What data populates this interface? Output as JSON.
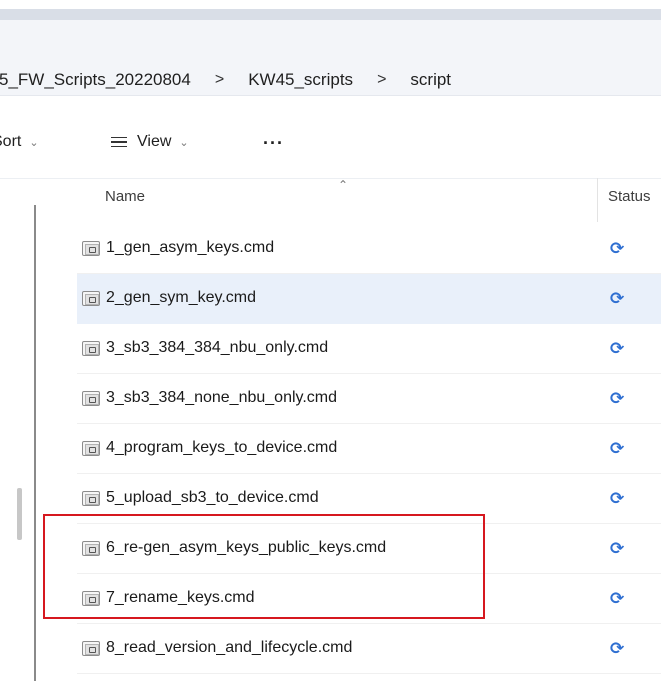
{
  "breadcrumb": {
    "items": [
      "5_FW_Scripts_20220804",
      "KW45_scripts",
      "script"
    ],
    "separator": ">"
  },
  "toolbar": {
    "sort_label": "Sort",
    "view_label": "View",
    "more_label": "..."
  },
  "columns": {
    "name": "Name",
    "status": "Status"
  },
  "files": [
    {
      "name": "1_gen_asym_keys.cmd",
      "status_icon": "sync-pending-icon"
    },
    {
      "name": "2_gen_sym_key.cmd",
      "status_icon": "sync-pending-icon",
      "selected": true
    },
    {
      "name": "3_sb3_384_384_nbu_only.cmd",
      "status_icon": "sync-pending-icon"
    },
    {
      "name": "3_sb3_384_none_nbu_only.cmd",
      "status_icon": "sync-pending-icon"
    },
    {
      "name": "4_program_keys_to_device.cmd",
      "status_icon": "sync-pending-icon"
    },
    {
      "name": "5_upload_sb3_to_device.cmd",
      "status_icon": "sync-pending-icon"
    },
    {
      "name": "6_re-gen_asym_keys_public_keys.cmd",
      "status_icon": "sync-pending-icon",
      "highlighted": true
    },
    {
      "name": "7_rename_keys.cmd",
      "status_icon": "sync-pending-icon",
      "highlighted": true
    },
    {
      "name": "8_read_version_and_lifecycle.cmd",
      "status_icon": "sync-pending-icon"
    }
  ],
  "colors": {
    "selection": "#e9f0fa",
    "sync_icon": "#2f6fd1",
    "highlight_border": "#d6181f"
  }
}
